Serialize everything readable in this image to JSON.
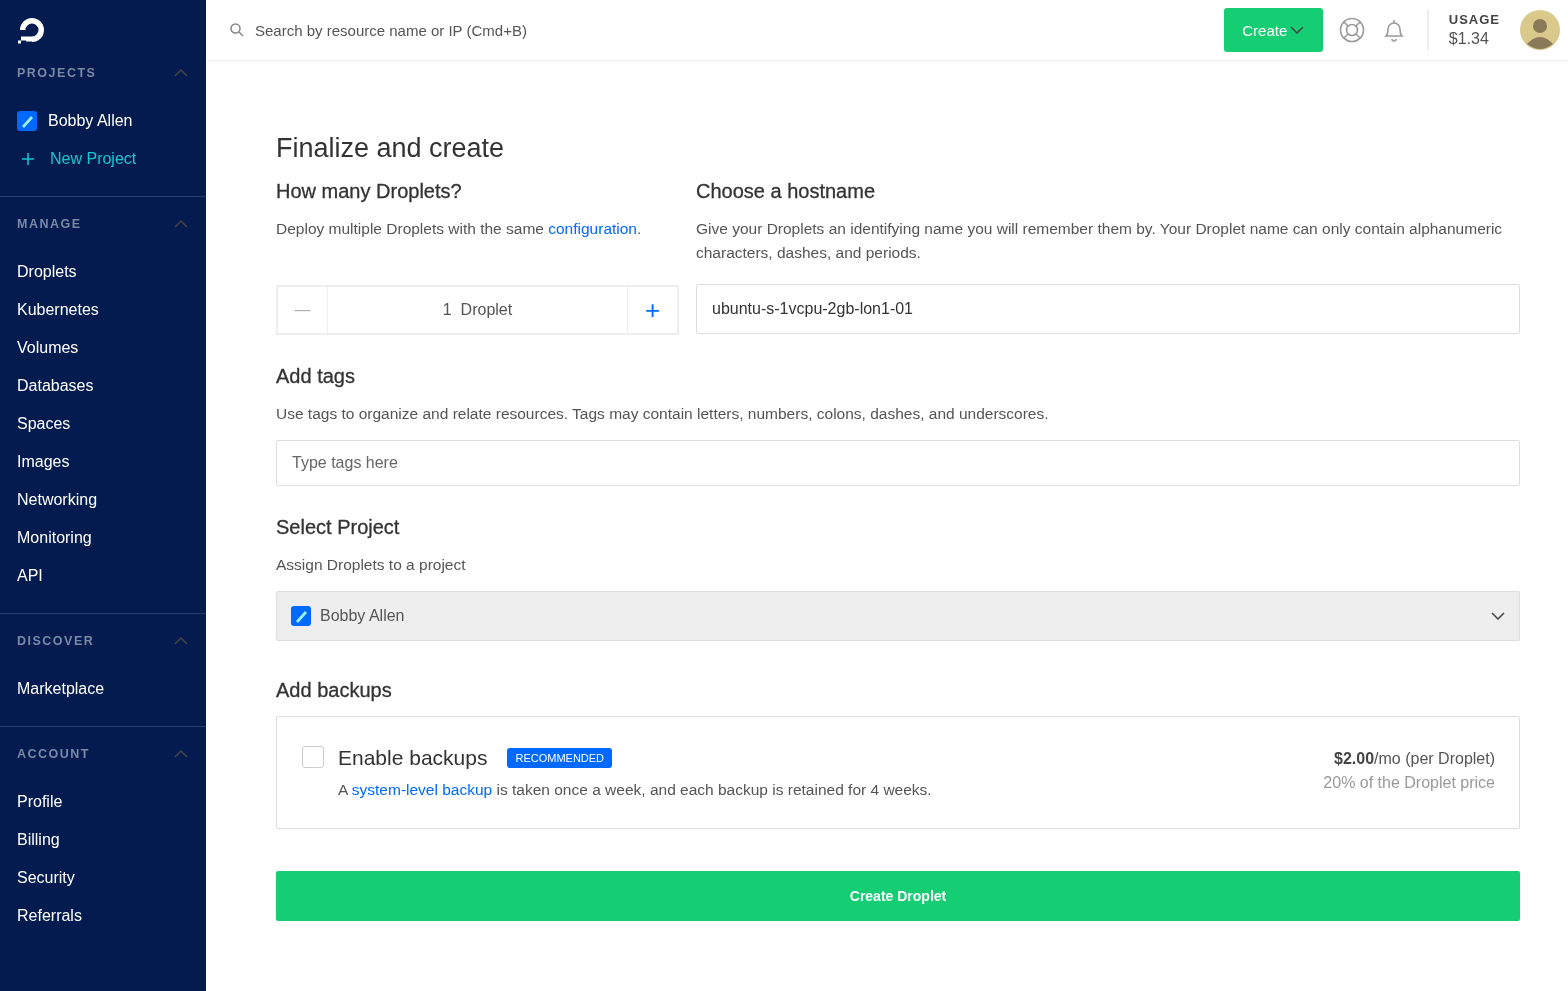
{
  "sidebar": {
    "sections": [
      {
        "title": "PROJECTS",
        "expanded": true,
        "items": [
          {
            "label": "Bobby Allen",
            "kind": "project"
          },
          {
            "label": "New Project",
            "kind": "add"
          }
        ]
      },
      {
        "title": "MANAGE",
        "expanded": true,
        "items": [
          {
            "label": "Droplets",
            "kind": "link"
          },
          {
            "label": "Kubernetes",
            "kind": "link"
          },
          {
            "label": "Volumes",
            "kind": "link"
          },
          {
            "label": "Databases",
            "kind": "link"
          },
          {
            "label": "Spaces",
            "kind": "link"
          },
          {
            "label": "Images",
            "kind": "link"
          },
          {
            "label": "Networking",
            "kind": "link"
          },
          {
            "label": "Monitoring",
            "kind": "link"
          },
          {
            "label": "API",
            "kind": "link"
          }
        ]
      },
      {
        "title": "DISCOVER",
        "expanded": true,
        "items": [
          {
            "label": "Marketplace",
            "kind": "link"
          }
        ]
      },
      {
        "title": "ACCOUNT",
        "expanded": true,
        "items": [
          {
            "label": "Profile",
            "kind": "link"
          },
          {
            "label": "Billing",
            "kind": "link"
          },
          {
            "label": "Security",
            "kind": "link"
          },
          {
            "label": "Referrals",
            "kind": "link"
          }
        ]
      }
    ]
  },
  "topbar": {
    "search": {
      "placeholder": "Search by resource name or IP (Cmd+B)"
    },
    "create_button": "Create",
    "usage": {
      "label": "USAGE",
      "amount": "$1.34"
    }
  },
  "page_title": "Finalize and create",
  "droplet_count": {
    "heading": "How many Droplets?",
    "text_before": "Deploy multiple Droplets with the same ",
    "link": "configuration",
    "text_after": ".",
    "decrement": "—",
    "value": "1  Droplet",
    "decrement_disabled": true,
    "increment": "+"
  },
  "hostname": {
    "heading": "Choose a hostname",
    "description": "Give your Droplets an identifying name you will remember them by. Your Droplet name can only contain alphanumeric characters, dashes, and periods.",
    "value": "ubuntu-s-1vcpu-2gb-lon1-01"
  },
  "tags": {
    "heading": "Add tags",
    "description": "Use tags to organize and relate resources. Tags may contain letters, numbers, colons, dashes, and underscores.",
    "placeholder": "Type tags here"
  },
  "project": {
    "heading": "Select Project",
    "description": "Assign Droplets to a project",
    "selected": "Bobby Allen"
  },
  "backups": {
    "heading": "Add backups",
    "label": "Enable backups",
    "checked": false,
    "badge": "RECOMMENDED",
    "text_before": "A ",
    "link": "system-level backup",
    "text_after": " is taken once a week, and each backup is retained for 4 weeks.",
    "price": "**$2.00**/mo (per Droplet)",
    "price_note": "20% of the Droplet price"
  },
  "submit": "Create Droplet"
}
